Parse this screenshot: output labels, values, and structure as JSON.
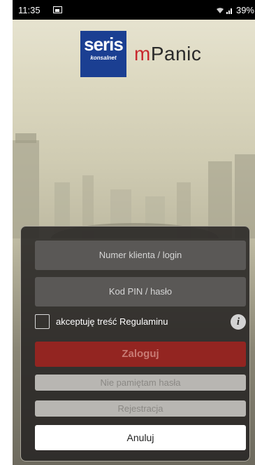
{
  "status_bar": {
    "time": "11:35",
    "battery": "39%"
  },
  "brand": {
    "logo_main": "seris",
    "logo_sub": "konsalnet",
    "app_name_first": "m",
    "app_name_rest": "Panic",
    "logo_color": "#1b3f92",
    "accent_color": "#c8282e"
  },
  "login_form": {
    "login_placeholder": "Numer klienta / login",
    "pin_placeholder": "Kod PIN / hasło",
    "terms_label": "akceptuję treść Regulaminu",
    "terms_checked": false,
    "info_icon": "i",
    "login_button": "Zaloguj",
    "forgot_password_button": "Nie pamiętam hasła",
    "register_button": "Rejestracja",
    "cancel_button": "Anuluj"
  }
}
